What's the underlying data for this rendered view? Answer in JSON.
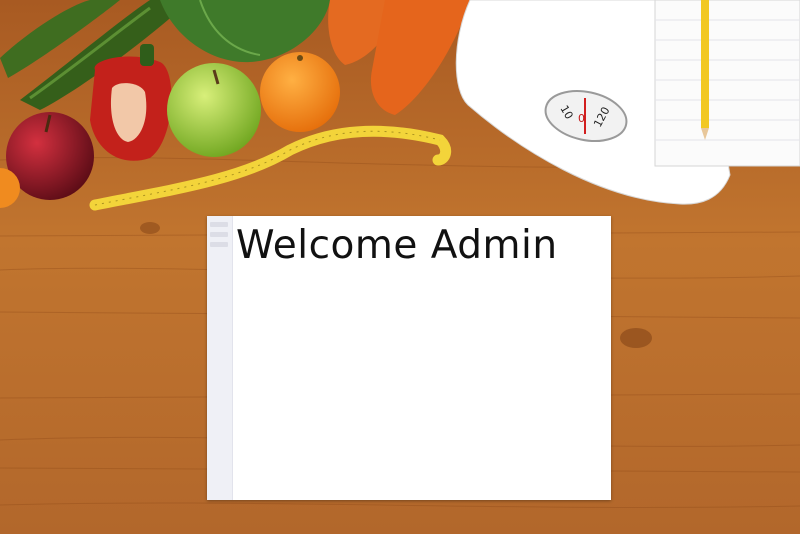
{
  "background": {
    "description_icons": [
      "cucumber-icon",
      "bell-pepper-icon",
      "green-apple-icon",
      "orange-icon",
      "carrot-icon",
      "red-apple-icon",
      "measuring-tape-icon",
      "bathroom-scale-icon",
      "notepad-icon",
      "pencil-icon"
    ],
    "scale_dial_labels": [
      "10",
      "0",
      "120"
    ],
    "wood_color": "#b8692a"
  },
  "main_panel": {
    "title": "Welcome Admin"
  },
  "colors": {
    "panel_bg": "#ffffff",
    "sidebar_bg": "#eff0f6",
    "title_color": "#111111"
  }
}
